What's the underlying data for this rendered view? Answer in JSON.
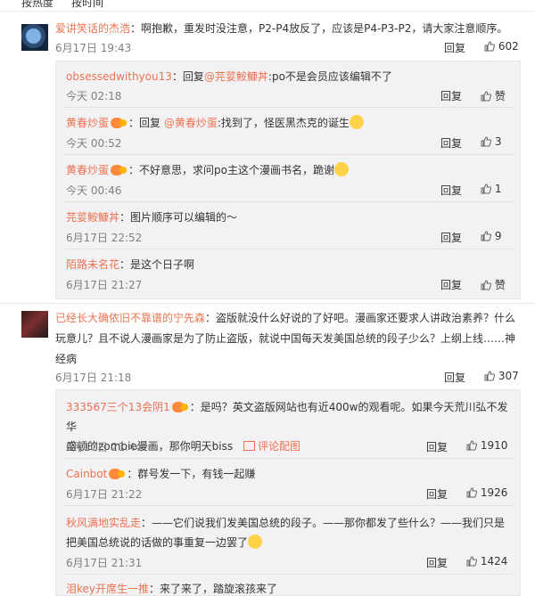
{
  "sort": {
    "hot": "按热度",
    "time": "按时间"
  },
  "reply_label": "回复",
  "comments": [
    {
      "user": "爱讲笑话的杰浩",
      "text": "：啊抱歉，重发时没注意，P2-P4放反了，应该是P4-P3-P2，请大家注意顺序。",
      "time": "6月17日 19:43",
      "likes": "602",
      "replies": [
        {
          "user": "obsessedwithyou13",
          "text": "：回复",
          "mention": "@芫荽鮟鱇丼",
          "text2": ":po不是会员应该编辑不了",
          "time": "今天 02:18",
          "likes": "赞"
        },
        {
          "user": "黄春炒蛋",
          "text": "：回复 ",
          "mention": "@黄春炒蛋",
          "text2": ":找到了，怪医黑杰克的诞生",
          "time": "今天 00:52",
          "likes": "3"
        },
        {
          "user": "黄春炒蛋",
          "text": "：不好意思，求问po主这个漫画书名，跪谢",
          "time": "今天 00:46",
          "likes": "1"
        },
        {
          "user": "芫荽鮟鱇丼",
          "text": "：图片顺序可以编辑的～",
          "time": "6月17日 22:52",
          "likes": "9"
        },
        {
          "user": "陌路未名花",
          "text": "：是这个日子啊",
          "time": "6月17日 21:27",
          "likes": "赞"
        }
      ]
    },
    {
      "user": "已经长大确依旧不靠谱的宁先森",
      "text_line1": "：盗版就没什么好说的了好吧。漫画家还要求人讲政治素养？什么",
      "text_line2": "玩意儿？且不说人漫画家是为了防止盗版，就说中国每天发美国总统的段子少么？上纲上线……神",
      "text_line3": "经病",
      "time": "6月17日 21:18",
      "likes": "307",
      "replies": [
        {
          "user": "333567三个13会阴1",
          "text_line1": "：是吗？英文盗版网站也有近400w的观看呢。如果今天荒川弘不发华",
          "text_line2": "盛顿的zombie漫画，那你明天biss",
          "img_label": "评论配图",
          "time": "6月17日 21:44",
          "likes": "1910"
        },
        {
          "user": "Cainbot",
          "text": "：群号发一下，有钱一起赚",
          "time": "6月17日 21:22",
          "likes": "1926"
        },
        {
          "user": "秋风满地实乱走",
          "text_line1": "：——它们说我们发美国总统的段子。——那你都发了些什么？——我们只是",
          "text_line2": "把美国总统说的话做的事重复一边罢了",
          "time": "6月17日 21:31",
          "likes": "1424"
        },
        {
          "user": "泪key开席生一推",
          "text": "：来了来了，踏旋滚孩来了"
        }
      ]
    }
  ],
  "colors": {
    "user": "#eb7350",
    "reply_bg": "#f2f2f5",
    "time": "#808080"
  }
}
